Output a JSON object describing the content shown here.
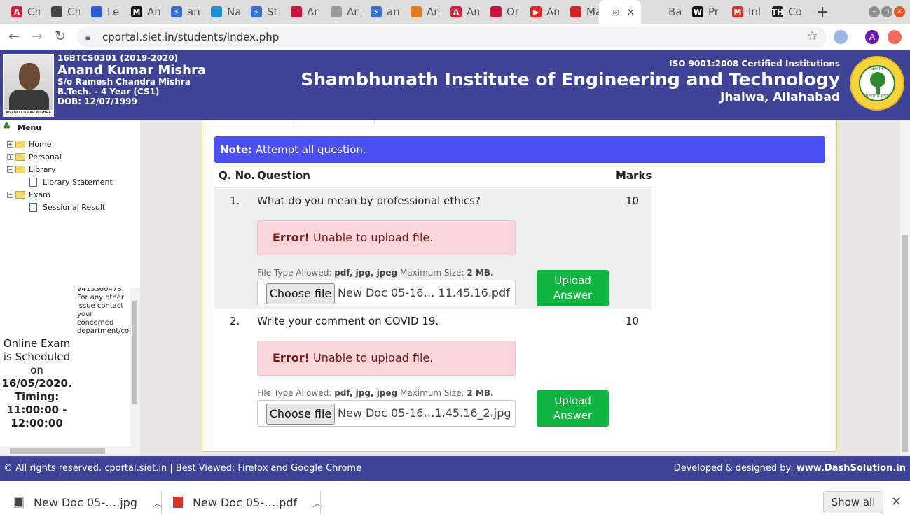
{
  "browser": {
    "tabs": [
      {
        "label": "Ch",
        "icon_text": "A",
        "color": "#dd1c3a"
      },
      {
        "label": "Ch",
        "icon_text": "",
        "color": "#444"
      },
      {
        "label": "Le",
        "icon_text": "",
        "color": "#2a5bd7"
      },
      {
        "label": "An",
        "icon_text": "M",
        "color": "#111"
      },
      {
        "label": "an",
        "icon_text": "⚡",
        "color": "#3b6fd8"
      },
      {
        "label": "Na",
        "icon_text": "",
        "color": "#1f8fd6"
      },
      {
        "label": "St",
        "icon_text": "⚡",
        "color": "#3b6fd8"
      },
      {
        "label": "An",
        "icon_text": "",
        "color": "#c7153f"
      },
      {
        "label": "An",
        "icon_text": "",
        "color": "#999"
      },
      {
        "label": "an",
        "icon_text": "⚡",
        "color": "#3b6fd8"
      },
      {
        "label": "An",
        "icon_text": "",
        "color": "#e57d1f"
      },
      {
        "label": "An",
        "icon_text": "A",
        "color": "#dd1c3a"
      },
      {
        "label": "Or",
        "icon_text": "",
        "color": "#c7153f"
      },
      {
        "label": "An",
        "icon_text": "▶",
        "color": "#e52020"
      },
      {
        "label": "Ma",
        "icon_text": "",
        "color": "#d8202b"
      },
      {
        "label": "",
        "icon_text": "◎",
        "color": "#555",
        "active": true
      },
      {
        "label": "Ba",
        "icon_text": "",
        "color": "#dedede"
      },
      {
        "label": "Pr",
        "icon_text": "W",
        "color": "#111"
      },
      {
        "label": "Inl",
        "icon_text": "M",
        "color": "#d93025"
      },
      {
        "label": "Co",
        "icon_text": "TH",
        "color": "#222"
      }
    ],
    "tab_close": "×",
    "new_tab": "+",
    "url": "cportal.siet.in/students/index.php",
    "avatar_letter": "A"
  },
  "student": {
    "id_session": "16BTCS0301 (2019-2020)",
    "name": "Anand Kumar Mishra",
    "father": "S/o Ramesh Chandra Mishra",
    "course": "B.Tech. - 4 Year (CS1)",
    "dob": "DOB: 12/07/1999",
    "photo_caption": "ANAND KUMAR MISHRA"
  },
  "institute": {
    "iso": "ISO 9001:2008 Certified Institutions",
    "name": "Shambhunath Institute of Engineering and Technology",
    "location": "Jhalwa, Allahabad",
    "logo_top": "उत्थान",
    "logo_bottom": "अंधकार से प्रकाश"
  },
  "menu": {
    "title": "Menu",
    "items": [
      {
        "label": "Home",
        "toggle": "+"
      },
      {
        "label": "Personal",
        "toggle": "+"
      },
      {
        "label": "Library",
        "toggle": "−"
      },
      {
        "label": "Library Statement"
      },
      {
        "label": "Exam",
        "toggle": "−"
      },
      {
        "label": "Sessional Result"
      }
    ]
  },
  "notice": {
    "partial_text": "9415360478. For any other issue contact your concerned department/coll",
    "schedule_text": "Online Exam is Scheduled on",
    "date": "16/05/2020. Timing: 11:00:00 - 12:00:00"
  },
  "exam": {
    "note_label": "Note:",
    "note_text": " Attempt all question.",
    "headers": {
      "qno": "Q. No.",
      "question": "Question",
      "marks": "Marks"
    },
    "error_label": "Error!",
    "error_text": " Unable to upload file.",
    "allowed_label": "File Type Allowed:",
    "allowed_types": "pdf, jpg, jpeg",
    "max_label": "Maximum Size:",
    "max_size": "2 MB.",
    "choose_label": "Choose file",
    "upload_label": "Upload Answer",
    "questions": [
      {
        "num": "1.",
        "text": "What do you mean by professional ethics?",
        "marks": "10",
        "file": "New Doc 05-16… 11.45.16.pdf"
      },
      {
        "num": "2.",
        "text": "Write your comment on COVID 19.",
        "marks": "10",
        "file": "New Doc 05-16…1.45.16_2.jpg"
      }
    ]
  },
  "footer": {
    "left": "© All rights reserved. cportal.siet.in | Best Viewed: Firefox and Google Chrome",
    "right_prefix": "Developed & designed by: ",
    "right_link": "www.DashSolution.in"
  },
  "downloads": {
    "items": [
      {
        "name": "New Doc 05-….jpg"
      },
      {
        "name": "New Doc 05-….pdf"
      }
    ],
    "show_all": "Show all"
  }
}
